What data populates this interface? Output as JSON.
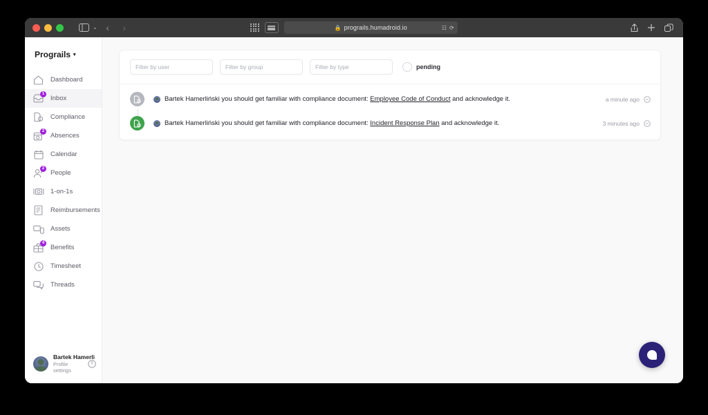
{
  "browser": {
    "url": "prograils.humadroid.io",
    "lock_icon": "lock-icon",
    "back_label": "‹",
    "forward_label": "›",
    "chevron_label": "⌄",
    "right_icons": [
      "share-icon",
      "new-tab-icon",
      "tab-overview-icon"
    ]
  },
  "sidebar": {
    "brand": "Prograils",
    "brand_caret": "▾",
    "items": [
      {
        "label": "Dashboard",
        "icon": "home-icon",
        "badge": "",
        "active": false
      },
      {
        "label": "Inbox",
        "icon": "inbox-icon",
        "badge": "1",
        "active": true
      },
      {
        "label": "Compliance",
        "icon": "compliance-icon",
        "badge": "",
        "active": false
      },
      {
        "label": "Absences",
        "icon": "absences-icon",
        "badge": "2",
        "active": false
      },
      {
        "label": "Calendar",
        "icon": "calendar-icon",
        "badge": "",
        "active": false
      },
      {
        "label": "People",
        "icon": "people-icon",
        "badge": "2",
        "active": false
      },
      {
        "label": "1-on-1s",
        "icon": "one-on-one-icon",
        "badge": "",
        "active": false
      },
      {
        "label": "Reimbursements",
        "icon": "reimbursements-icon",
        "badge": "",
        "active": false
      },
      {
        "label": "Assets",
        "icon": "assets-icon",
        "badge": "",
        "active": false
      },
      {
        "label": "Benefits",
        "icon": "benefits-icon",
        "badge": "4",
        "active": false
      },
      {
        "label": "Timesheet",
        "icon": "timesheet-icon",
        "badge": "",
        "active": false
      },
      {
        "label": "Threads",
        "icon": "threads-icon",
        "badge": "",
        "active": false
      }
    ],
    "profile": {
      "name": "Bartek Hamerli",
      "subtitle": "Profile settings",
      "power_icon": "power-icon"
    }
  },
  "main": {
    "filters": {
      "user_placeholder": "Filter by user",
      "user_value": "",
      "group_placeholder": "Filter by group",
      "group_value": "",
      "type_placeholder": "Filter by type",
      "type_value": "",
      "pending_label": "pending",
      "pending_checked": false
    },
    "rows": [
      {
        "avatar_color": "#b4b7bd",
        "avatar_state": "gray",
        "text_before": "Bartek Hamerliński you should get familiar with compliance document: ",
        "link": "Employee Code of Conduct",
        "text_after": " and acknowledge it.",
        "time": "a minute ago",
        "status_icon": "pending-circle-icon"
      },
      {
        "avatar_color": "#3ea34b",
        "avatar_state": "green",
        "text_before": "Bartek Hamerliński you should get familiar with compliance document: ",
        "link": "Incident Response Plan",
        "text_after": " and acknowledge it.",
        "time": "3 minutes ago",
        "status_icon": "pending-circle-icon"
      }
    ]
  },
  "chat": {
    "icon": "chat-bubble-icon",
    "color": "#2b2277"
  },
  "colors": {
    "badge": "#a020dd",
    "accent_green": "#3ea34b",
    "page_bg": "#f9f9f9",
    "titlebar": "#3a3a3a"
  }
}
